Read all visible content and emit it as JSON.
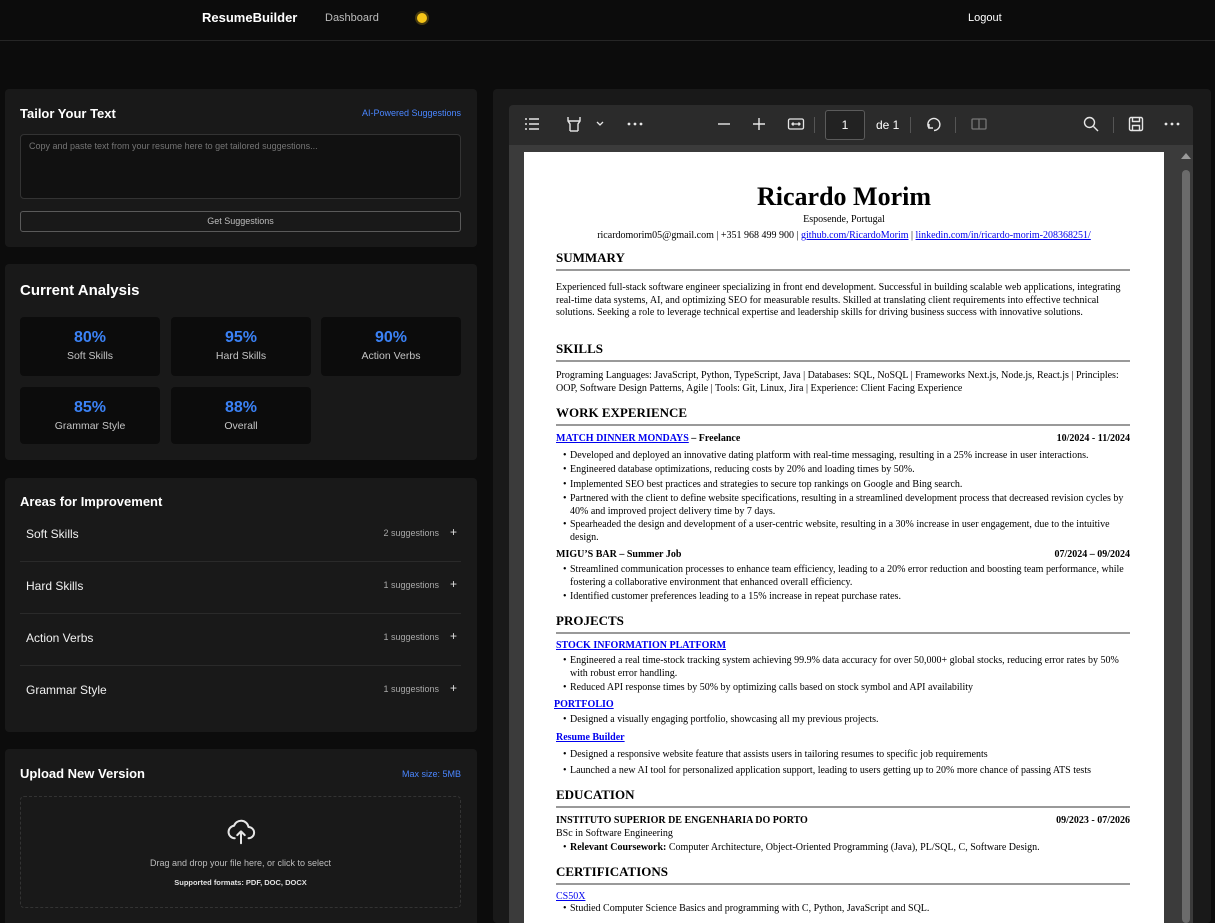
{
  "nav": {
    "brand": "ResumeBuilder",
    "dashboard": "Dashboard",
    "logout": "Logout"
  },
  "tailor": {
    "title": "Tailor Your Text",
    "tag": "AI-Powered Suggestions",
    "placeholder": "Copy and paste text from your resume here to get tailored suggestions...",
    "button": "Get Suggestions"
  },
  "analysis": {
    "title": "Current Analysis",
    "cards": [
      {
        "value": "80%",
        "label": "Soft Skills"
      },
      {
        "value": "95%",
        "label": "Hard Skills"
      },
      {
        "value": "90%",
        "label": "Action Verbs"
      },
      {
        "value": "85%",
        "label": "Grammar Style"
      },
      {
        "value": "88%",
        "label": "Overall"
      }
    ]
  },
  "improvement": {
    "title": "Areas for Improvement",
    "items": [
      {
        "name": "Soft Skills",
        "count": "2 suggestions"
      },
      {
        "name": "Hard Skills",
        "count": "1 suggestions"
      },
      {
        "name": "Action Verbs",
        "count": "1 suggestions"
      },
      {
        "name": "Grammar Style",
        "count": "1 suggestions"
      }
    ]
  },
  "upload": {
    "title": "Upload New Version",
    "tag": "Max size: 5MB",
    "drop_text": "Drag and drop your file here, or click to select",
    "formats": "Supported formats: PDF, DOC, DOCX"
  },
  "viewer": {
    "page_current": "1",
    "page_of": "de 1"
  },
  "resume": {
    "name": "Ricardo Morim",
    "location": "Esposende, Portugal",
    "email_phone": "ricardomorim05@gmail.com | +351 968 499 900 |",
    "github": "github.com/RicardoMorim",
    "linkedin": "linkedin.com/in/ricardo-morim-208368251/",
    "summary_h": "SUMMARY",
    "summary": "Experienced full-stack software engineer specializing in front end development. Successful in building scalable web applications, integrating real-time data systems, AI, and optimizing SEO for measurable results. Skilled at translating client requirements into effective technical solutions. Seeking a role to leverage technical expertise and leadership skills for driving business success with innovative solutions.",
    "skills_h": "SKILLS",
    "skills": "Programing Languages: JavaScript, Python, TypeScript, Java | Databases: SQL, NoSQL | Frameworks Next.js, Node.js, React.js | Principles: OOP, Software Design Patterns, Agile | Tools: Git, Linux, Jira | Experience: Client Facing Experience",
    "work_h": "WORK EXPERIENCE",
    "job1_title": "MATCH DINNER MONDAYS",
    "job1_role": " – Freelance",
    "job1_date": "10/2024 - 11/2024",
    "job1_b1": "Developed and deployed an innovative dating platform with real-time messaging, resulting in a 25% increase in user interactions.",
    "job1_b2": "Engineered database optimizations, reducing costs by 20% and loading times by 50%.",
    "job1_b3": "Implemented SEO best practices and strategies to secure top rankings on Google and Bing search.",
    "job1_b4": "Partnered with the client to define website specifications, resulting in a streamlined development process that decreased revision cycles by 40% and improved project delivery time by 7 days.",
    "job1_b5": "Spearheaded the design and development of a user-centric website, resulting in a 30% increase in user engagement, due to the intuitive design.",
    "job2_title": "MIGU’S BAR – Summer Job",
    "job2_date": "07/2024 – 09/2024",
    "job2_b1": "Streamlined communication processes to enhance team efficiency, leading to a 20% error reduction and boosting team performance, while fostering a collaborative environment that enhanced overall efficiency.",
    "job2_b2": "Identified customer preferences leading to a 15% increase in repeat purchase rates.",
    "projects_h": "PROJECTS",
    "proj1": "STOCK INFORMATION PLATFORM",
    "proj1_b1": "Engineered a real time-stock tracking system achieving 99.9% data accuracy for over 50,000+ global stocks, reducing error rates by 50% with robust error handling.",
    "proj1_b2": "Reduced API response times by 50% by optimizing calls based on stock symbol and API availability",
    "proj2": "PORTFOLIO",
    "proj2_b1": "Designed a visually engaging portfolio, showcasing all my previous projects.",
    "proj3": "Resume Builder",
    "proj3_b1": "Designed a responsive website feature that assists users in tailoring resumes to specific job requirements",
    "proj3_b2": "Launched a new AI tool for personalized application support, leading to users getting up to 20% more chance of passing ATS tests",
    "edu_h": "EDUCATION",
    "edu_school": "INSTITUTO SUPERIOR DE ENGENHARIA DO PORTO",
    "edu_date": "09/2023 - 07/2026",
    "edu_degree": "BSc in Software Engineering",
    "edu_course_label": "Relevant Coursework:",
    "edu_course": " Computer Architecture, Object-Oriented Programming (Java), PL/SQL, C, Software Design.",
    "cert_h": "CERTIFICATIONS",
    "cert1": "CS50X",
    "cert1_b1": "Studied Computer Science Basics and programming with C, Python, JavaScript and SQL."
  }
}
